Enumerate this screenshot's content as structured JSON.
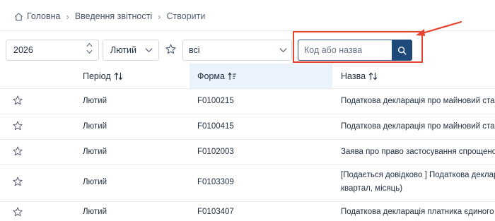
{
  "breadcrumb": {
    "home": "Головна",
    "reporting": "Введення звітності",
    "create": "Створити"
  },
  "filters": {
    "year": "2026",
    "month": "Лютий",
    "kind": "всі",
    "search_placeholder": "Код або назва"
  },
  "table": {
    "headers": {
      "period": "Період",
      "form": "Форма",
      "name": "Назва"
    },
    "rows": [
      {
        "period": "Лютий",
        "form": "F0100215",
        "name": "Податкова декларація про майновий стан і доходи",
        "name2": ""
      },
      {
        "period": "Лютий",
        "form": "F0100415",
        "name": "Податкова декларація про майновий стан і доходи",
        "name2": ""
      },
      {
        "period": "Лютий",
        "form": "F0102003",
        "name": "Заява про право застосування спрощеної системи",
        "name2": ""
      },
      {
        "period": "Лютий",
        "form": "F0103309",
        "name": "[Подається довідково ] Податкова декларація",
        "name2": "квартал, місяць)"
      },
      {
        "period": "Лютий",
        "form": "F0103407",
        "name": "Податкова декларація платника єдиного податку",
        "name2": ""
      }
    ]
  },
  "colors": {
    "accent": "#1e4a7a",
    "highlight": "#e8432e",
    "form_column_bg": "#eaf2fb"
  }
}
